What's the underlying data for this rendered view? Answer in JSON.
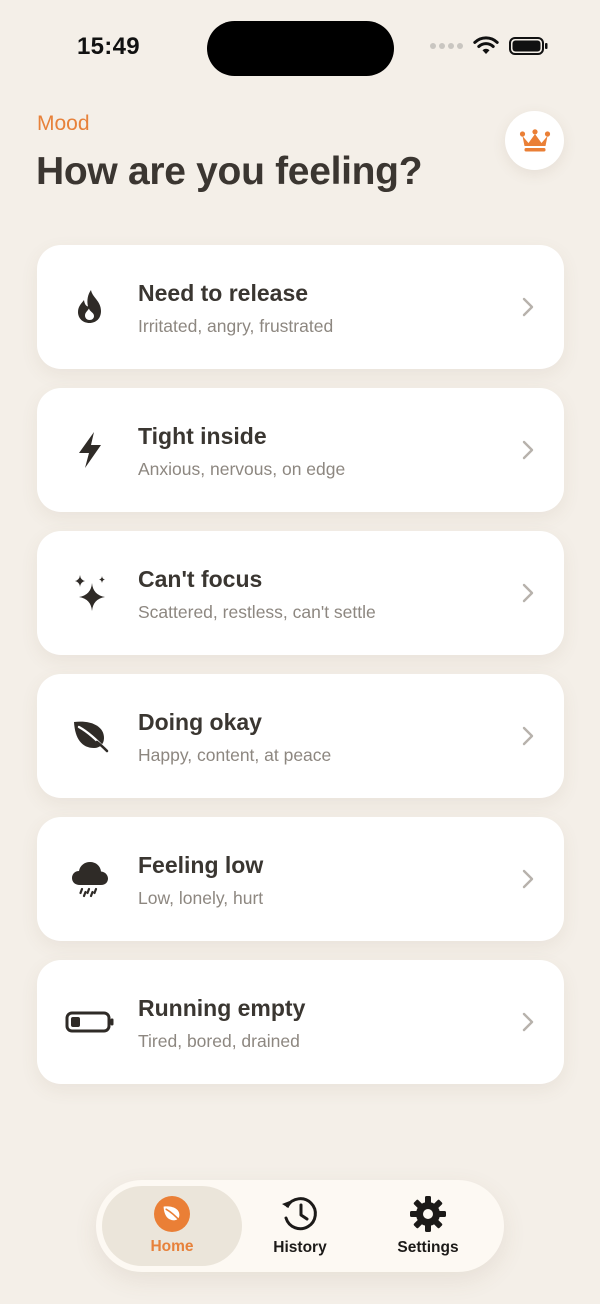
{
  "status_bar": {
    "time": "15:49"
  },
  "header": {
    "eyebrow": "Mood",
    "title": "How are you feeling?"
  },
  "moods": [
    {
      "title": "Need to release",
      "subtitle": "Irritated, angry, frustrated",
      "icon": "flame-icon"
    },
    {
      "title": "Tight inside",
      "subtitle": "Anxious, nervous, on edge",
      "icon": "lightning-icon"
    },
    {
      "title": "Can't focus",
      "subtitle": "Scattered, restless, can't settle",
      "icon": "sparkles-icon"
    },
    {
      "title": "Doing okay",
      "subtitle": "Happy, content, at peace",
      "icon": "leaf-icon"
    },
    {
      "title": "Feeling low",
      "subtitle": "Low, lonely, hurt",
      "icon": "rain-cloud-icon"
    },
    {
      "title": "Running empty",
      "subtitle": "Tired, bored, drained",
      "icon": "battery-low-icon"
    }
  ],
  "tabs": [
    {
      "label": "Home",
      "icon": "leaf-icon",
      "active": true
    },
    {
      "label": "History",
      "icon": "history-clock-icon",
      "active": false
    },
    {
      "label": "Settings",
      "icon": "gear-icon",
      "active": false
    }
  ],
  "colors": {
    "accent": "#e7813a",
    "background": "#f4efe8",
    "card": "#ffffff",
    "text": "#3a3631",
    "subtext": "#8d8780"
  }
}
